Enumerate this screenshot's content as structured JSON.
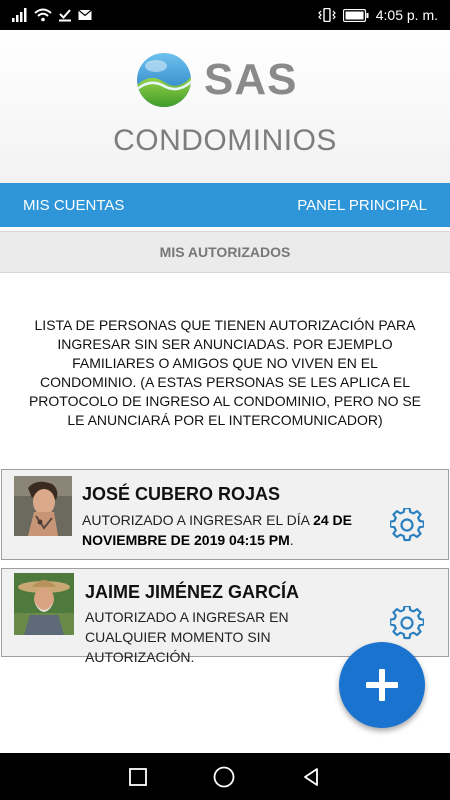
{
  "status_bar": {
    "time": "4:05 p. m.",
    "icons": [
      "signal-icon",
      "wifi-icon",
      "download-done-icon",
      "mail-icon",
      "vibrate-icon",
      "battery-icon"
    ]
  },
  "header": {
    "logo_text": "SAS",
    "title": "CONDOMINIOS"
  },
  "nav": {
    "left": "MIS CUENTAS",
    "right": "PANEL PRINCIPAL"
  },
  "section": {
    "title": "MIS AUTORIZADOS"
  },
  "description": "LISTA DE PERSONAS QUE TIENEN AUTORIZACIÓN PARA INGRESAR SIN SER ANUNCIADAS. POR EJEMPLO FAMILIARES O AMIGOS QUE NO VIVEN EN EL CONDOMINIO. (A ESTAS PERSONAS SE LES APLICA EL PROTOCOLO DE INGRESO AL CONDOMINIO, PERO NO SE LE ANUNCIARÁ POR EL INTERCOMUNICADOR)",
  "people": [
    {
      "name": "JOSÉ CUBERO ROJAS",
      "desc_prefix": "AUTORIZADO A INGRESAR EL DÍA ",
      "desc_bold": "24 DE NOVIEMBRE DE 2019 04:15 PM",
      "desc_suffix": "."
    },
    {
      "name": "JAIME JIMÉNEZ GARCÍA",
      "desc": "AUTORIZADO A INGRESAR EN CUALQUIER MOMENTO SIN AUTORIZACIÓN."
    }
  ],
  "colors": {
    "accent": "#2d95d8",
    "fab": "#1a73cf",
    "gear": "#2a7fbf",
    "logo_text": "#8a8a8a"
  },
  "fab": {
    "icon": "plus-icon"
  },
  "system_nav": {
    "icons": [
      "recents-square-icon",
      "home-circle-icon",
      "back-triangle-icon"
    ]
  }
}
